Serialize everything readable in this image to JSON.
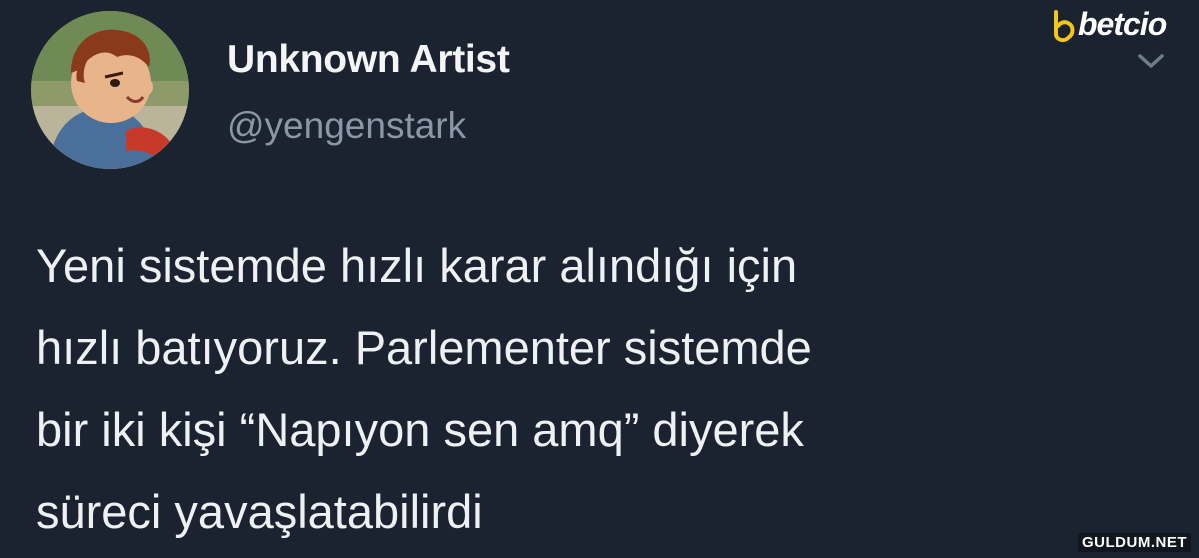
{
  "author": {
    "display_name": "Unknown Artist",
    "handle": "@yengenstark",
    "avatar_icon": "cartoon-boy-avatar"
  },
  "tweet": {
    "lines": [
      "Yeni sistemde hızlı karar alındığı için",
      "hızlı batıyoruz. Parlementer sistemde",
      "bir iki kişi “Napıyon sen amq” diyerek",
      "süreci yavaşlatabilirdi"
    ]
  },
  "menu_icon": "chevron-down-icon",
  "watermarks": {
    "top_right": "betcio",
    "bottom_right": "GULDUM.NET"
  },
  "colors": {
    "background": "#1b2230",
    "text_primary": "#eef1f4",
    "text_secondary": "#8a97a6",
    "logo_accent": "#f5c518"
  }
}
